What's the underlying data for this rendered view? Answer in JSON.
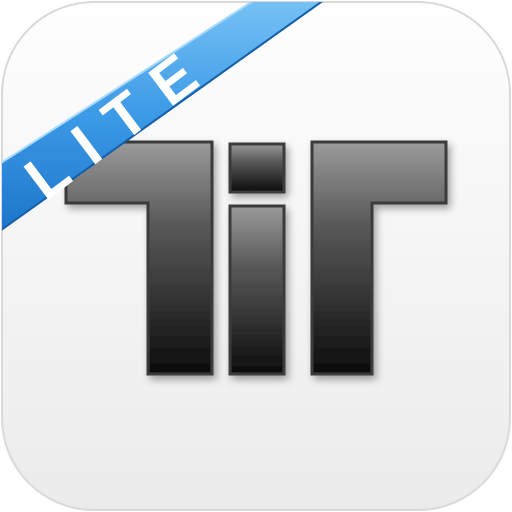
{
  "icon": {
    "kind": "app-icon",
    "logo_text": "TiT",
    "ribbon_label": "LITE"
  },
  "colors": {
    "tile_top": "#fefefe",
    "tile_bottom": "#ececec",
    "tile_edge": "#d8d8d8",
    "glyph_top": "#8c8c8c",
    "glyph_bottom": "#0e0e0e",
    "ribbon_light": "#5fb6f5",
    "ribbon_dark": "#1c7fd6",
    "ribbon_text": "#ffffff"
  }
}
